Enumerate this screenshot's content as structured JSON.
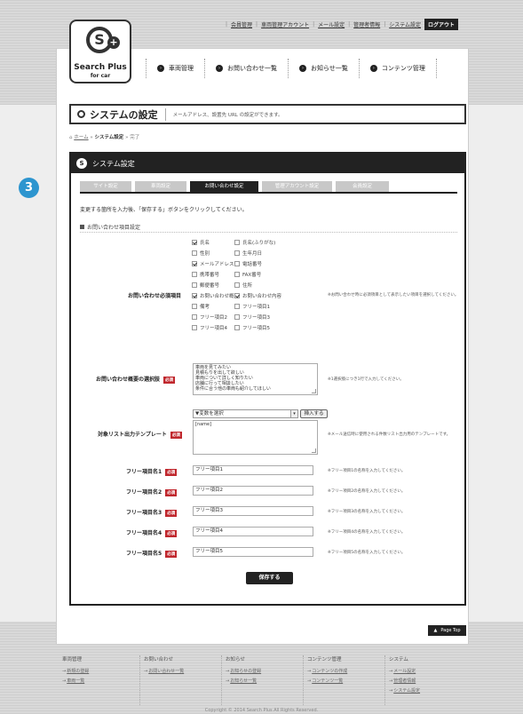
{
  "header": {
    "util_links": [
      "会員管理",
      "車両管理アカウント",
      "メール設定",
      "管理者情報",
      "システム設定"
    ],
    "logout": "ログアウト",
    "logo_mark": "S",
    "logo_plus": "+",
    "logo_title": "Search Plus",
    "logo_subtitle": "for car"
  },
  "gnav": [
    {
      "label": "車両管理"
    },
    {
      "label": "お問い合わせ一覧"
    },
    {
      "label": "お知らせ一覧"
    },
    {
      "label": "コンテンツ管理"
    }
  ],
  "page_title": {
    "title": "システムの設定",
    "description": "メールアドレス、設置先 URL の設定ができます。"
  },
  "breadcrumb": {
    "home": "ホーム",
    "current": "システム設定",
    "sub": "完了",
    "sep": "»"
  },
  "step_number": "3",
  "panel": {
    "title": "システム設定",
    "tabs": [
      {
        "label": "サイト設定",
        "active": false
      },
      {
        "label": "車両設定",
        "active": false
      },
      {
        "label": "お問い合わせ設定",
        "active": true
      },
      {
        "label": "管理アカウント設定",
        "active": false
      },
      {
        "label": "会員設定",
        "active": false
      }
    ],
    "intro": "変更する箇所を入力後、「保存する」ボタンをクリックしてください。",
    "section": "お問い合わせ項目設定"
  },
  "required_label": "必須",
  "form": {
    "required_items_label": "お問い合わせ必須項目",
    "required_items_note": "※お問い合わせ時に必須項目として表示したい項目を選択してください。",
    "checkboxes": [
      {
        "label": "氏名",
        "checked": true
      },
      {
        "label": "氏名(ふりがな)",
        "checked": false
      },
      {
        "label": "性別",
        "checked": false
      },
      {
        "label": "生年月日",
        "checked": false
      },
      {
        "label": "メールアドレス",
        "checked": true
      },
      {
        "label": "電話番号",
        "checked": false
      },
      {
        "label": "携帯番号",
        "checked": false
      },
      {
        "label": "FAX番号",
        "checked": false
      },
      {
        "label": "郵便番号",
        "checked": false
      },
      {
        "label": "住所",
        "checked": false
      },
      {
        "label": "お問い合わせ概要",
        "checked": true
      },
      {
        "label": "お問い合わせ内容",
        "checked": true
      },
      {
        "label": "備考",
        "checked": false
      },
      {
        "label": "フリー項目1",
        "checked": false
      },
      {
        "label": "フリー項目2",
        "checked": false
      },
      {
        "label": "フリー項目3",
        "checked": false
      },
      {
        "label": "フリー項目4",
        "checked": false
      },
      {
        "label": "フリー項目5",
        "checked": false
      }
    ],
    "overview_label": "お問い合わせ概要の選択肢",
    "overview_value": "車両を見てみたい\n見積もりを出して欲しい\n車両について詳しく知りたい\n店舗に行って相談したい\n条件に合う他の車両も紹介してほしい",
    "overview_note": "※1選択肢につき1行で入力してください。",
    "template_label": "対象リスト出力テンプレート",
    "template_select": "▼変数を選択",
    "insert_button": "挿入する",
    "template_value": "[name]",
    "template_note": "※メール送信時に使用される件数リスト出力用のテンプレートです。",
    "free_items": [
      {
        "label": "フリー項目名1",
        "value": "フリー項目1",
        "note": "※フリー項目1の名称を入力してください。"
      },
      {
        "label": "フリー項目名2",
        "value": "フリー項目2",
        "note": "※フリー項目2の名称を入力してください。"
      },
      {
        "label": "フリー項目名3",
        "value": "フリー項目3",
        "note": "※フリー項目3の名称を入力してください。"
      },
      {
        "label": "フリー項目名4",
        "value": "フリー項目4",
        "note": "※フリー項目4の名称を入力してください。"
      },
      {
        "label": "フリー項目名5",
        "value": "フリー項目5",
        "note": "※フリー項目5の名称を入力してください。"
      }
    ],
    "save_button": "保存する"
  },
  "page_top": "Page Top",
  "footer": {
    "columns": [
      {
        "heading": "車両管理",
        "links": [
          "新規の登録",
          "車両一覧"
        ]
      },
      {
        "heading": "お問い合わせ",
        "links": [
          "お問い合わせ一覧"
        ]
      },
      {
        "heading": "お知らせ",
        "links": [
          "お知らせの登録",
          "お知らせ一覧"
        ]
      },
      {
        "heading": "コンテンツ管理",
        "links": [
          "コンテンツの作成",
          "コンテンツ一覧"
        ]
      },
      {
        "heading": "システム",
        "links": [
          "メール設定",
          "管理者情報",
          "システム設定"
        ]
      }
    ],
    "copyright": "Copyright © 2014 Search Plus All Rights Reserved."
  },
  "colors": {
    "accent_blue": "#2d95cf",
    "required_red": "#c0272d",
    "dark": "#222222"
  }
}
